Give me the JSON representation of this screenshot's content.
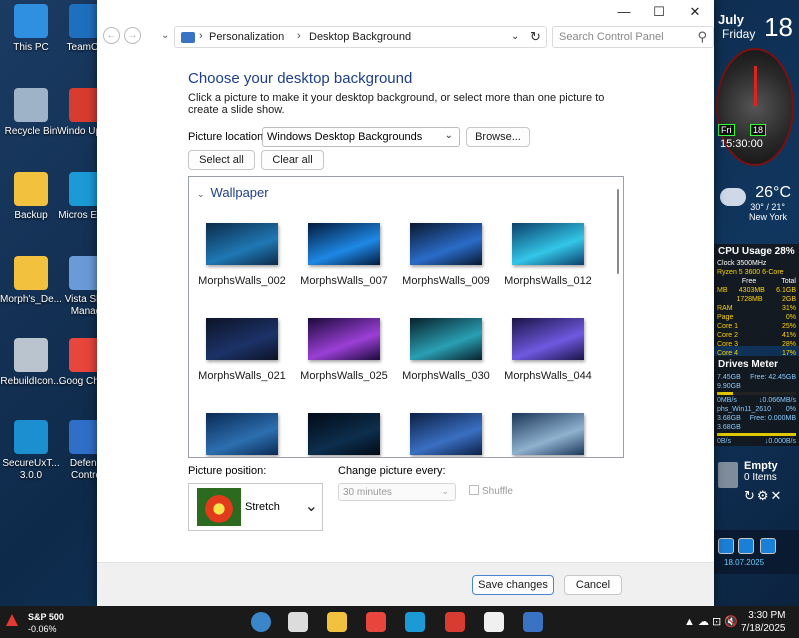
{
  "desktop_icons": [
    {
      "label": "This PC",
      "color": "#2f8fe0"
    },
    {
      "label": "TeamOS",
      "color": "#1f6fbf"
    },
    {
      "label": "Recycle Bin",
      "color": "#9fb3c8"
    },
    {
      "label": "Windo Updat",
      "color": "#d83b30"
    },
    {
      "label": "Backup",
      "color": "#f2c13d"
    },
    {
      "label": "Micros Edge",
      "color": "#1b9ad6"
    },
    {
      "label": "Morph's_De...",
      "color": "#f2c13d"
    },
    {
      "label": "Vista Sho Manag",
      "color": "#6a9bd8"
    },
    {
      "label": "RebuildIcon...",
      "color": "#b9c4cf"
    },
    {
      "label": "Goog Chron",
      "color": "#e8453c"
    },
    {
      "label": "SecureUxT... 3.0.0",
      "color": "#1c8fd0"
    },
    {
      "label": "Defend Contro",
      "color": "#2f6fc8"
    }
  ],
  "widgets": {
    "date": {
      "month": "July",
      "day": "Friday",
      "num": "18"
    },
    "clock": {
      "box1": "Fri",
      "box2": "18",
      "time": "15:30:00"
    },
    "weather": {
      "temp": "26°C",
      "range": "30° / 21°",
      "city": "New York"
    },
    "cpu": {
      "title": "CPU Usage 28%",
      "clock": "Clock 3500MHz",
      "model": "Ryzen 5 3600 6-Core",
      "header": [
        "",
        "Free",
        "Total"
      ],
      "rows": [
        {
          "a": "MB",
          "b": "4303MB",
          "c": "6.1GB"
        },
        {
          "a": "",
          "b": "1728MB",
          "c": "2GB"
        },
        {
          "a": "RAM",
          "b": "",
          "c": "31%"
        },
        {
          "a": "Page",
          "b": "",
          "c": "0%"
        },
        {
          "a": "Core 1",
          "b": "",
          "c": "25%"
        },
        {
          "a": "Core 2",
          "b": "",
          "c": "41%"
        },
        {
          "a": "Core 3",
          "b": "",
          "c": "28%"
        },
        {
          "a": "Core 4",
          "b": "",
          "c": "17%"
        }
      ]
    },
    "drives": {
      "title": "Drives Meter",
      "rows": [
        {
          "a": "7.45GB",
          "b": "Free: 42.45GB"
        },
        {
          "a": "9.90GB",
          "b": ""
        },
        {
          "a": "0MB/s",
          "b": "↓0.066MB/s"
        },
        {
          "a": "phs_Win11_2610",
          "b": "0%"
        },
        {
          "a": "3.68GB",
          "b": "Free: 0.000MB"
        },
        {
          "a": "3.68GB",
          "b": ""
        },
        {
          "a": "0B/s",
          "b": "↓0.000B/s"
        }
      ],
      "bar1": 0.2,
      "bar2": 1.0
    },
    "bin": {
      "title": "Empty",
      "items": "0 Items",
      "controls": "↻⚙✕"
    },
    "dock": {
      "date": "18.07.2025"
    }
  },
  "window": {
    "controls": {
      "minimize": "—",
      "maximize": "☐",
      "close": "✕"
    },
    "nav": {
      "back": "←",
      "forward": "→",
      "recent": "⌄"
    },
    "address": {
      "crumb1": "Personalization",
      "sep": "›",
      "crumb2": "Desktop Background",
      "dropdown": "⌄",
      "refresh": "↻"
    },
    "search": {
      "placeholder": "Search Control Panel",
      "icon": "search-icon"
    },
    "heading": "Choose your desktop background",
    "description": "Click a picture to make it your desktop background, or select more than one picture to create a slide show.",
    "location_label": "Picture location:",
    "location_value": "Windows Desktop Backgrounds",
    "browse": "Browse...",
    "select_all": "Select all",
    "clear_all": "Clear all",
    "group": "Wallpaper",
    "thumbnails": [
      {
        "label": "MorphsWalls_002",
        "colors": [
          "#0d2b4a",
          "#1f78b4"
        ]
      },
      {
        "label": "MorphsWalls_007",
        "colors": [
          "#041a3c",
          "#1e88e5"
        ]
      },
      {
        "label": "MorphsWalls_009",
        "colors": [
          "#0a1830",
          "#2a6cc9"
        ]
      },
      {
        "label": "MorphsWalls_012",
        "colors": [
          "#0b3f6a",
          "#33c6e8"
        ]
      },
      {
        "label": "MorphsWalls_021",
        "colors": [
          "#0c1326",
          "#1c3268"
        ]
      },
      {
        "label": "MorphsWalls_025",
        "colors": [
          "#1b0a3a",
          "#9b3fd6"
        ]
      },
      {
        "label": "MorphsWalls_030",
        "colors": [
          "#08202b",
          "#2a9fb3"
        ]
      },
      {
        "label": "MorphsWalls_044",
        "colors": [
          "#1a1446",
          "#6f59e0"
        ]
      },
      {
        "label": "",
        "colors": [
          "#0a2a55",
          "#2d6fb0"
        ]
      },
      {
        "label": "",
        "colors": [
          "#020a16",
          "#0d2e4d"
        ]
      },
      {
        "label": "",
        "colors": [
          "#0b1f44",
          "#3a6fc2"
        ]
      },
      {
        "label": "",
        "colors": [
          "#1b3658",
          "#8fb2cf"
        ]
      }
    ],
    "position_label": "Picture position:",
    "position_value": "Stretch",
    "change_label": "Change picture every:",
    "change_value": "30 minutes",
    "shuffle": "Shuffle",
    "save": "Save changes",
    "cancel": "Cancel"
  },
  "taskbar": {
    "stock_name": "S&P 500",
    "stock_change": "-0.06%",
    "apps": [
      {
        "name": "alienware-icon",
        "color": "#3a86c8"
      },
      {
        "name": "desktop-icon",
        "color": "#dcdcdc"
      },
      {
        "name": "file-explorer-icon",
        "color": "#f2c13d"
      },
      {
        "name": "chrome-icon",
        "color": "#e8453c"
      },
      {
        "name": "edge-icon",
        "color": "#1b9ad6"
      },
      {
        "name": "app-icon",
        "color": "#d83b30"
      },
      {
        "name": "store-icon",
        "color": "#f0f0f0"
      },
      {
        "name": "control-panel-icon",
        "color": "#3a72c4"
      }
    ],
    "tray": "▲ ☁ ⊡ 🔇",
    "time": "3:30 PM",
    "date": "7/18/2025"
  }
}
